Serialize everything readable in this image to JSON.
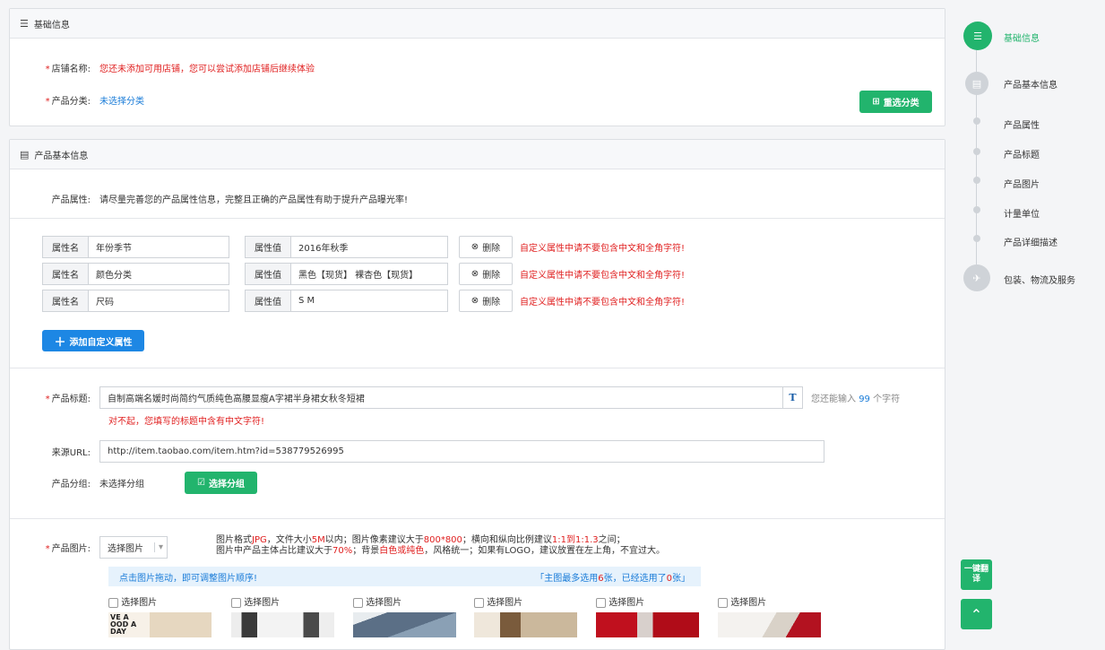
{
  "basic": {
    "title": "基础信息",
    "shop_label": "店铺名称:",
    "shop_value": "您还未添加可用店铺，您可以尝试添加店铺后继续体验",
    "category_label": "产品分类:",
    "category_value": "未选择分类",
    "reselect_button": "重选分类"
  },
  "product": {
    "title": "产品基本信息",
    "attr_label": "产品属性:",
    "attr_hint": "请尽量完善您的产品属性信息，完整且正确的产品属性有助于提升产品曝光率!",
    "attr_name_label": "属性名",
    "attr_value_label": "属性值",
    "delete_label": "删除",
    "attr_warning": "自定义属性中请不要包含中文和全角字符!",
    "attributes": [
      {
        "name": "年份季节",
        "value": "2016年秋季"
      },
      {
        "name": "颜色分类",
        "value": "黑色【现货】 裸杏色【现货】"
      },
      {
        "name": "尺码",
        "value": "S M"
      }
    ],
    "add_attr_button": "添加自定义属性",
    "title_label": "产品标题:",
    "title_value": "自制高端名媛时尚简约气质纯色高腰显瘦A字裙半身裙女秋冬短裙",
    "title_remaining_prefix": "您还能输入",
    "title_remaining_count": "99",
    "title_remaining_suffix": "个字符",
    "title_error": "对不起，您填写的标题中含有中文字符!",
    "url_label": "来源URL:",
    "url_value": "http://item.taobao.com/item.htm?id=538779526995",
    "group_label": "产品分组:",
    "group_value": "未选择分组",
    "group_button": "选择分组",
    "image_label": "产品图片:",
    "image_select": "选择图片",
    "image_hint_line1_a": "图片格式",
    "image_hint_line1_b": "JPG",
    "image_hint_line1_c": "，文件大小",
    "image_hint_line1_d": "5M",
    "image_hint_line1_e": "以内；图片像素建议大于",
    "image_hint_line1_f": "800*800",
    "image_hint_line1_g": "；横向和纵向比例建议",
    "image_hint_line1_h": "1:1到1:1.3",
    "image_hint_line1_i": "之间；",
    "image_hint_line2_a": "图片中产品主体占比建议大于",
    "image_hint_line2_b": "70%",
    "image_hint_line2_c": "；背景",
    "image_hint_line2_d": "白色或纯色",
    "image_hint_line2_e": "，风格统一；如果有LOGO，建议放置在左上角，不宜过大。",
    "drag_hint": "点击图片拖动，即可调整图片顺序!",
    "main_image_prefix": "「主图最多选用",
    "main_image_max": "6",
    "main_image_mid": "张，已经选用了",
    "main_image_count": "0",
    "main_image_suffix": "张」",
    "thumb_label": "选择图片",
    "thumb_logo_text": "VE A OOD A DAY"
  },
  "nav": {
    "items": [
      "基础信息",
      "产品基本信息",
      "产品属性",
      "产品标题",
      "产品图片",
      "计量单位",
      "产品详细描述",
      "包装、物流及服务"
    ],
    "translate_button": "一键翻译",
    "back_to_top": "返回顶部"
  },
  "colors": {
    "accent_green": "#22b46d",
    "accent_blue": "#1d87e4",
    "error_red": "#e02020"
  }
}
